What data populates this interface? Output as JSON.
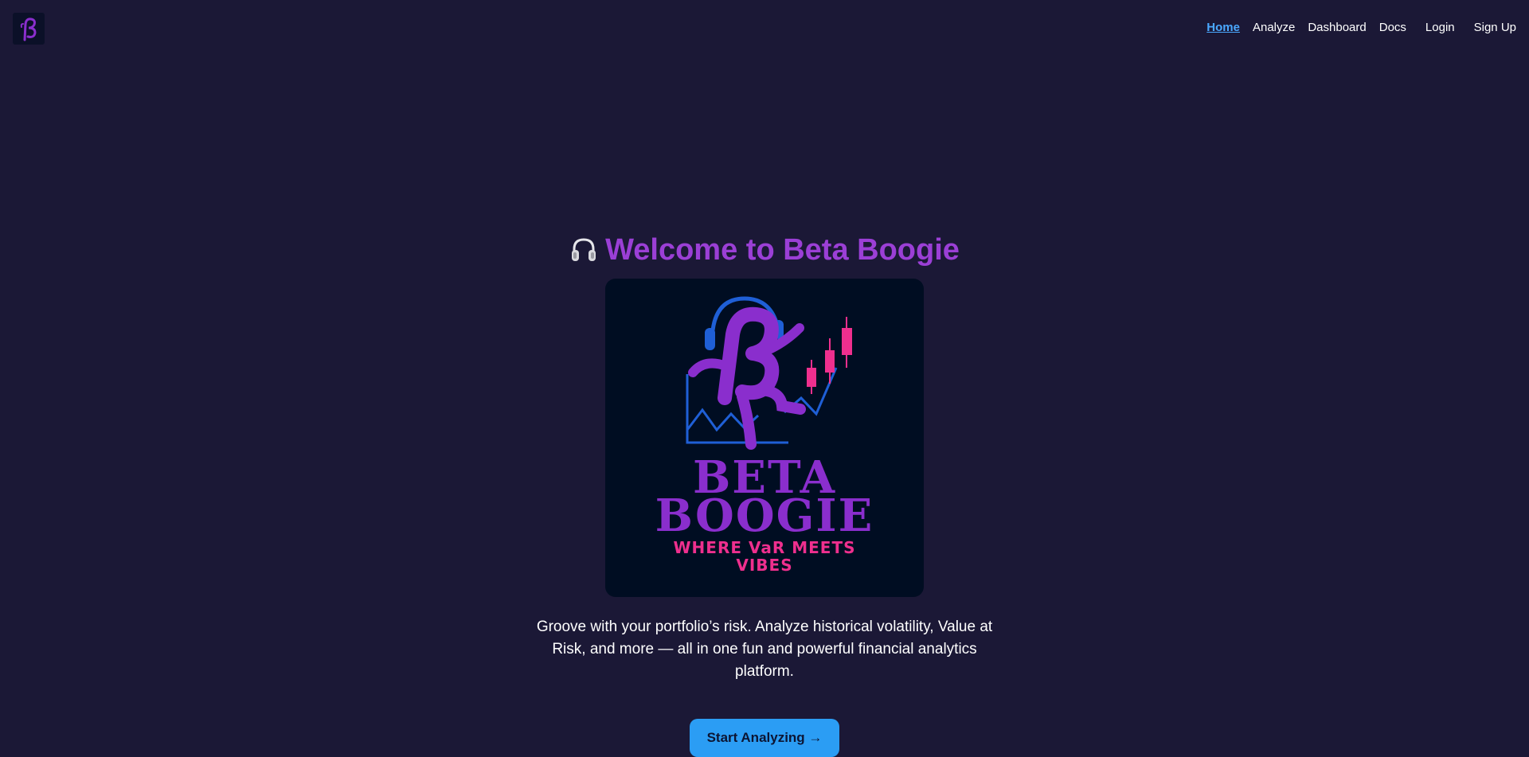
{
  "nav": {
    "home": "Home",
    "analyze": "Analyze",
    "dashboard": "Dashboard",
    "docs": "Docs",
    "login": "Login",
    "signup": "Sign Up",
    "active_item": "Home"
  },
  "hero": {
    "title_icon": "headphone-icon",
    "title": "Welcome to Beta Boogie",
    "logo": {
      "brand_line1": "BETA",
      "brand_line2": "BOOGIE",
      "tagline_line1": "WHERE VaR MEETS",
      "tagline_line2": "VIBES"
    },
    "description": "Groove with your portfolio’s risk. Analyze historical volatility, Value at Risk, and more — all in one fun and powerful financial analytics platform.",
    "cta_label": "Start Analyzing →"
  },
  "colors": {
    "background": "#1b1836",
    "title_purple": "#9b3fd6",
    "active_link": "#4aa8ff",
    "button_blue": "#2b9df4",
    "logo_bg": "#000d22",
    "logo_pink": "#ef2f8e",
    "logo_blue": "#1f5fd6"
  }
}
